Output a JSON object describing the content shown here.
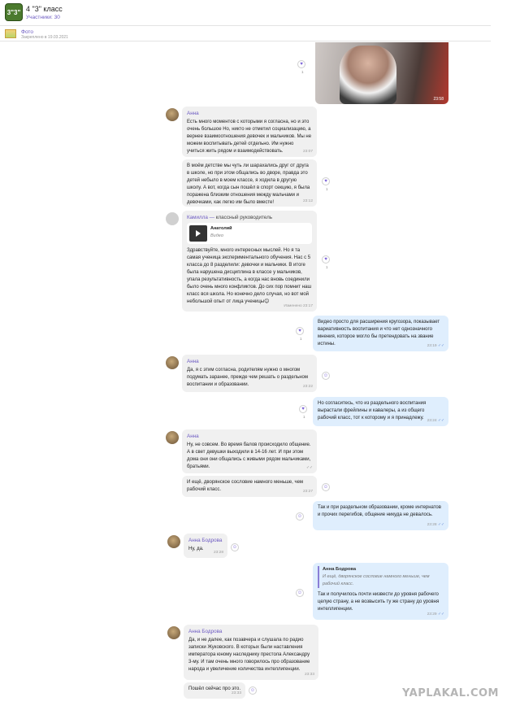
{
  "header": {
    "avatar_text": "3\"3\"",
    "title": "4 \"3\" класс",
    "members": "Участники: 30"
  },
  "pinned": {
    "label": "Фото",
    "sub": "Закреплено в 19.03.2021"
  },
  "video": {
    "time": "23:58"
  },
  "messages": [
    {
      "name": "Анна",
      "text": "Есть много моментов с которыми я согласна, но и это очень большое Но, никто не отметил социализацию, а вернее взаимоотношения девочек и мальчиков. Мы не можем воспитывать детей отдельно. Им нужно учиться жить рядом и взаимодействовать.",
      "time": "23:07"
    },
    {
      "text": "В моём детстве мы чуть ли шарахались друг от друга в школе, но при этом общались во дворе, правда это детей небыло в моем классе, я ходила в другую школу. А вот, когда сын пошёл в спорт секцию, я была поражена близким отношения между мальчами и девочками, как легко им было вместе!",
      "time": "23:12"
    },
    {
      "name": "Камилла",
      "role": "классный руководитель",
      "fwd_name": "Анатолий",
      "fwd_type": "Видео",
      "text": "Здравствуйте, много интересных мыслей. Но я та самая ученица экспериментального обучения. Нас с 5 класса до 8 разделили: девочки и мальчики. В итоге была нарушена дисциплина в классе у мальчиков, упала результативность, а когда нас вновь соединили было очень много конфликтов. До сих пор помнит наш класс вся школа. Но конечно дело случая, но вот мой небольшой опыт от лица ученицы😊",
      "time": "Изменено 23:17"
    },
    {
      "text": "Видео просто для расширения кругозора, показывает вариативность  воспитания и что нет однозначного мнения, которое могло бы претендовать на звание истины.",
      "time": "23:19"
    },
    {
      "name": "Анна",
      "text": "Да, я с этим согласна, родителям нужно о многом подумать заранее, прежде чем решать о раздельном воспитании и образовании.",
      "time": "23:22"
    },
    {
      "text": "Но согласитесь, что из раздельного воспитания вырастали фрейлины и кавалеры, а из общего рабочий класс, тот к которому и я принадлежу.",
      "time": "23:24"
    },
    {
      "name": "Анна",
      "text": "Ну, не совсем. Во время балов происходило общение. А в свет девушки выходили в 14-16 лет. И при этом дома они они общались с живыми рядом мальчиками, братьями.",
      "time": ""
    },
    {
      "text": "И ещё, дворянское сословие намного меньше, чем рабочий класс.",
      "time": "23:27"
    },
    {
      "text": "Так и при раздельном образовании, кроме интернатов и прочих перегибов, общение никуда не девалось.",
      "time": "23:28"
    },
    {
      "name": "Анна Бодрова",
      "text": "Ну, да.",
      "time": "23:28"
    },
    {
      "quote_name": "Анна Бодрова",
      "quote_text": "И ещё, дворянское сословие намного меньше, чем рабочий класс.",
      "text": "Так и получилось почти низвести до уровня рабочего целую страну, а не возвысить ту же страну до уровня интеллигенции.",
      "time": "23:29"
    },
    {
      "name": "Анна Бодрова",
      "text": "Да, и не далее, как позавчера и слушала по радио записки Жуковского. В которых были  наставления императора юному наследнику престола Александру 3-му. И там очень много говорилось про образование народа и увеличение количества интеллигенции.",
      "time": "23:33"
    },
    {
      "text": "Пошёл сейчас про это.",
      "time": "23:33"
    }
  ],
  "reactions": {
    "heart": "♥",
    "count": "1",
    "smile": "☺"
  },
  "watermark": "YAPLAKAL.COM",
  "colors": {
    "accent": "#6d5bc2",
    "outgoing": "#dfeefd",
    "incoming": "#f0f0f0"
  }
}
